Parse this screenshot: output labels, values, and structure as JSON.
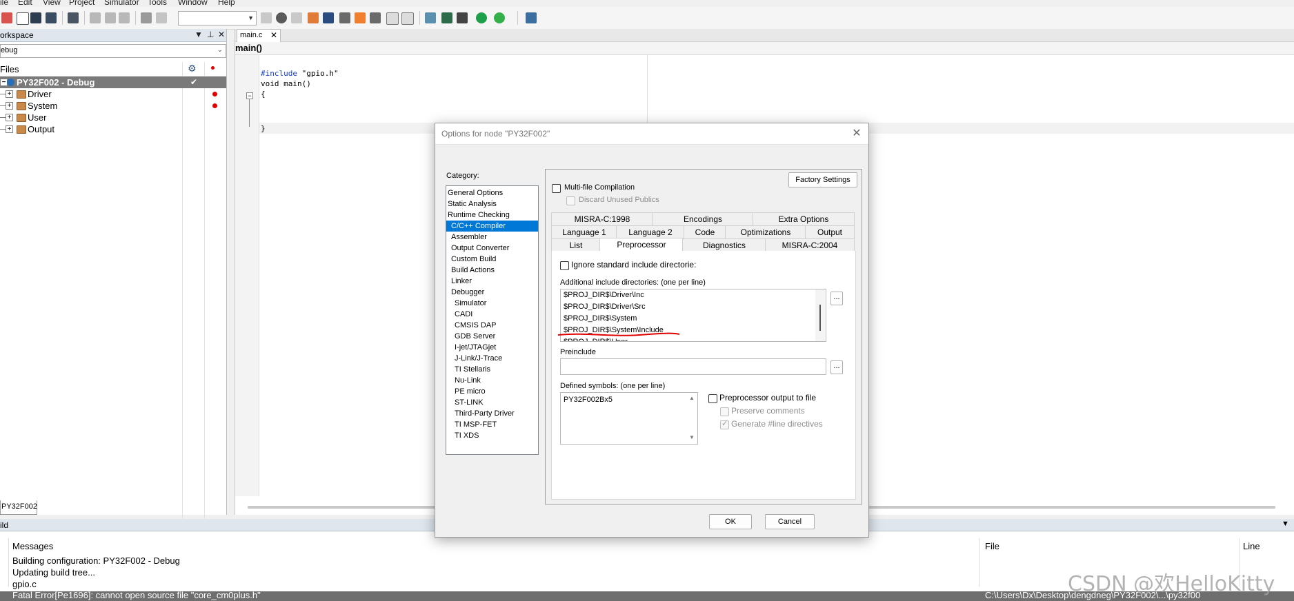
{
  "menubar": [
    "ile",
    "Edit",
    "View",
    "Project",
    "Simulator",
    "Tools",
    "Window",
    "Help"
  ],
  "workspace": {
    "title": "orkspace",
    "config": "ebug",
    "files_header": "Files",
    "tree": [
      {
        "label": "PY32F002 - Debug",
        "check": "✔"
      },
      {
        "label": "Driver"
      },
      {
        "label": "System"
      },
      {
        "label": "User"
      },
      {
        "label": "Output"
      }
    ],
    "bottom_tab": "PY32F002"
  },
  "editor": {
    "tab": "main.c",
    "tab_close": "✕",
    "function": "main()",
    "code": {
      "include_kw": "#include",
      "include_file": " \"gpio.h\"",
      "line2": "void main()",
      "line3": "{",
      "line4": "}"
    }
  },
  "build": {
    "title": "ild",
    "col_messages": "Messages",
    "col_file": "File",
    "col_line": "Line",
    "lines": [
      "Building configuration: PY32F002 - Debug",
      "Updating build tree...",
      "gpio.c"
    ],
    "error": "Fatal Error[Pe1696]: cannot open source file \"core_cm0plus.h\"",
    "error_path": "C:\\Users\\Dx\\Desktop\\dengdneg\\PY32F002\\...\\py32f00"
  },
  "dialog": {
    "title": "Options for node \"PY32F002\"",
    "close": "✕",
    "category_label": "Category:",
    "categories": [
      {
        "label": "General Options",
        "indent": 0
      },
      {
        "label": "Static Analysis",
        "indent": 0
      },
      {
        "label": "Runtime Checking",
        "indent": 0
      },
      {
        "label": "C/C++ Compiler",
        "indent": 1,
        "selected": true
      },
      {
        "label": "Assembler",
        "indent": 1
      },
      {
        "label": "Output Converter",
        "indent": 1
      },
      {
        "label": "Custom Build",
        "indent": 1
      },
      {
        "label": "Build Actions",
        "indent": 1
      },
      {
        "label": "Linker",
        "indent": 1
      },
      {
        "label": "Debugger",
        "indent": 1
      },
      {
        "label": "Simulator",
        "indent": 2
      },
      {
        "label": "CADI",
        "indent": 2
      },
      {
        "label": "CMSIS DAP",
        "indent": 2
      },
      {
        "label": "GDB Server",
        "indent": 2
      },
      {
        "label": "I-jet/JTAGjet",
        "indent": 2
      },
      {
        "label": "J-Link/J-Trace",
        "indent": 2
      },
      {
        "label": "TI Stellaris",
        "indent": 2
      },
      {
        "label": "Nu-Link",
        "indent": 2
      },
      {
        "label": "PE micro",
        "indent": 2
      },
      {
        "label": "ST-LINK",
        "indent": 2
      },
      {
        "label": "Third-Party Driver",
        "indent": 2
      },
      {
        "label": "TI MSP-FET",
        "indent": 2
      },
      {
        "label": "TI XDS",
        "indent": 2
      }
    ],
    "factory_settings": "Factory Settings",
    "multifile": "Multi-file Compilation",
    "discard_unused": "Discard Unused Publics",
    "tabs_row1": [
      "MISRA-C:1998",
      "Encodings",
      "Extra Options"
    ],
    "tabs_row2": [
      "Language 1",
      "Language 2",
      "Code",
      "Optimizations",
      "Output"
    ],
    "tabs_row3": [
      "List",
      "Preprocessor",
      "Diagnostics",
      "MISRA-C:2004"
    ],
    "ignore_std": "Ignore standard include directorie:",
    "include_label": "Additional include directories: (one per line)",
    "include_dirs": [
      "$PROJ_DIR$\\Driver\\Inc",
      "$PROJ_DIR$\\Driver\\Src",
      "$PROJ_DIR$\\System",
      "$PROJ_DIR$\\System\\Include",
      "$PROJ_DIR$\\User"
    ],
    "browse": "...",
    "preinclude_label": "Preinclude",
    "preinclude_value": "",
    "symbols_label": "Defined symbols: (one per line)",
    "symbols": [
      "PY32F002Bx5"
    ],
    "pp_output": "Preprocessor output to file",
    "preserve_comments": "Preserve comments",
    "generate_line": "Generate #line directives",
    "ok": "OK",
    "cancel": "Cancel"
  },
  "watermark": "CSDN @欢HelloKitty",
  "colors": {
    "selection": "#0078d7",
    "annotation": "#e00000",
    "project_row": "#7a7a7a"
  }
}
